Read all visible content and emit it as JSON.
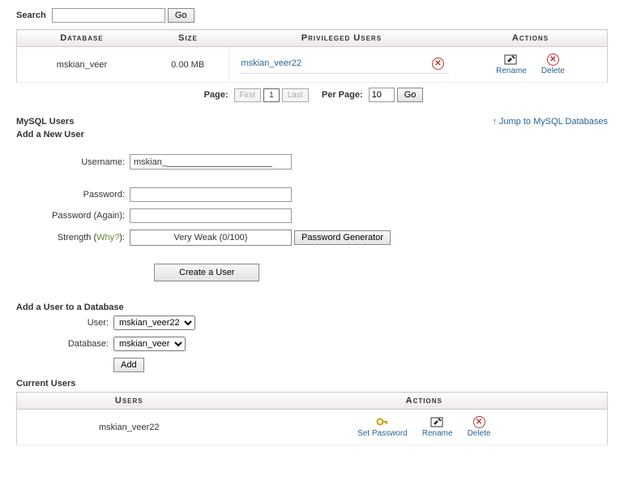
{
  "search": {
    "label": "Search",
    "go": "Go",
    "value": ""
  },
  "db_table": {
    "headers": [
      "Database",
      "Size",
      "Privileged Users",
      "Actions"
    ],
    "rows": [
      {
        "name": "mskian_veer",
        "size": "0.00 MB",
        "user": "mskian_veer22"
      }
    ],
    "rename": "Rename",
    "delete": "Delete"
  },
  "pager": {
    "page_label": "Page:",
    "first": "First",
    "page": "1",
    "last": "Last",
    "per_page_label": "Per Page:",
    "per_page_value": "10",
    "go": "Go"
  },
  "mysql_users_title": "MySQL Users",
  "add_user_title": "Add a New User",
  "jump_link": "Jump to MySQL Databases",
  "new_user": {
    "username_label": "Username:",
    "username_prefix": "mskian_",
    "username_value": "",
    "password_label": "Password:",
    "password_again_label": "Password (Again):",
    "strength_label": "Strength",
    "why": "Why?",
    "strength_value": "Very Weak (0/100)",
    "pwgen": "Password Generator",
    "create": "Create a User"
  },
  "add_to_db": {
    "title": "Add a User to a Database",
    "user_label": "User:",
    "user_value": "mskian_veer22",
    "db_label": "Database:",
    "db_value": "mskian_veer",
    "add": "Add"
  },
  "current_users": {
    "title": "Current Users",
    "headers": [
      "Users",
      "Actions"
    ],
    "rows": [
      {
        "name": "mskian_veer22"
      }
    ],
    "set_password": "Set Password",
    "rename": "Rename",
    "delete": "Delete"
  }
}
